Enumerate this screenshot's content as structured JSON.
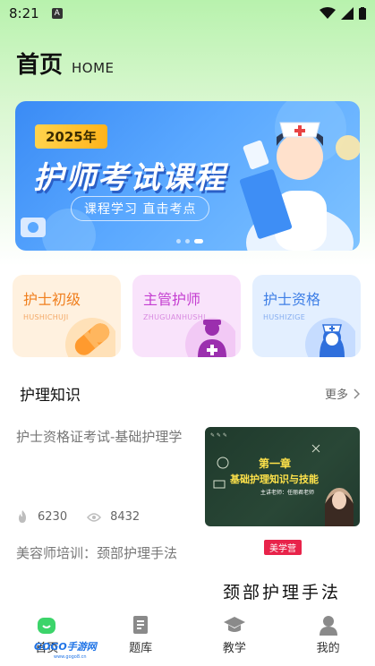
{
  "status_bar": {
    "time": "8:21",
    "notif_letter": "A"
  },
  "header": {
    "title": "首页",
    "subtitle": "HOME"
  },
  "banner": {
    "year": "2025年",
    "title": "护师考试课程",
    "subtitle": "课程学习 直击考点"
  },
  "cards": [
    {
      "title": "护士初级",
      "pinyin": "HUSHICHUJI",
      "icon": "capsule-icon"
    },
    {
      "title": "主管护师",
      "pinyin": "ZHUGUANHUSHI",
      "icon": "doctor-icon"
    },
    {
      "title": "护士资格",
      "pinyin": "HUSHIZIGE",
      "icon": "nurse-icon"
    }
  ],
  "section": {
    "title": "护理知识",
    "more": "更多"
  },
  "articles": [
    {
      "title": "护士资格证考试-基础护理学",
      "likes": "6230",
      "views": "8432",
      "thumb": {
        "chapter": "第一章",
        "headline": "基础护理知识与技能",
        "lecturer": "主讲老师：任丽君老师"
      }
    },
    {
      "title": "美容师培训：颈部护理手法",
      "thumb": {
        "badge": "美学营",
        "text": "颈部护理手法"
      }
    }
  ],
  "nav": [
    {
      "label": "首页",
      "icon": "home-icon",
      "active": true
    },
    {
      "label": "题库",
      "icon": "question-bank-icon"
    },
    {
      "label": "教学",
      "icon": "graduation-cap-icon"
    },
    {
      "label": "我的",
      "icon": "user-icon"
    }
  ],
  "watermark": {
    "brand": "GOGO手游网",
    "site": "www.gogo8.cn"
  },
  "colors": {
    "accent": "#3cd46a",
    "banner_blue": "#3a8bf5"
  }
}
